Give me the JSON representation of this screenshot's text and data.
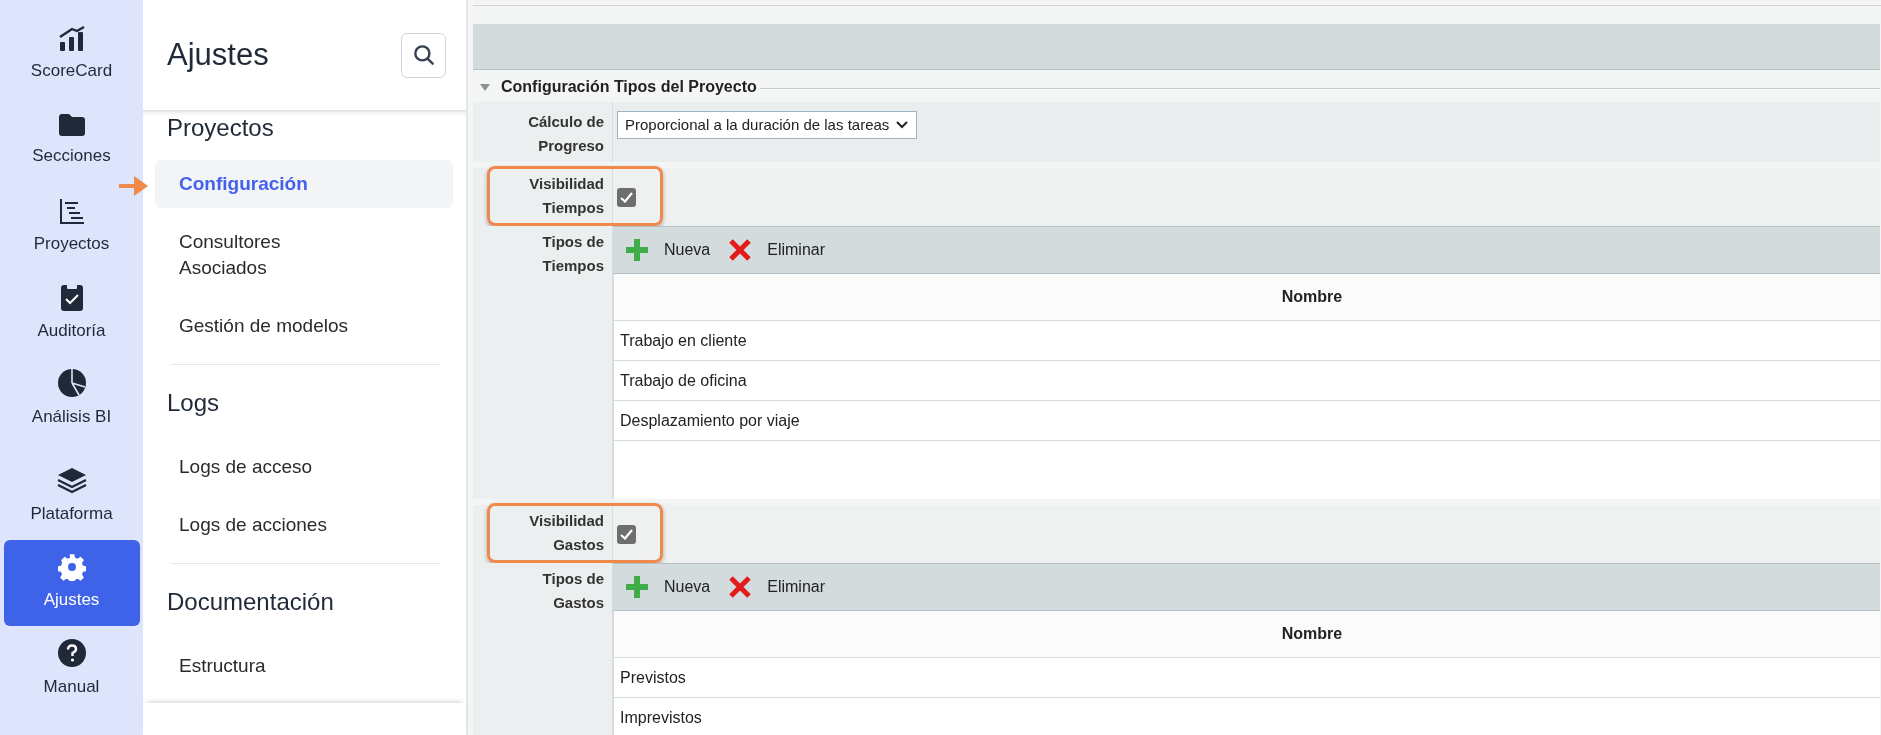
{
  "rail": [
    {
      "label": "ScoreCard",
      "selected": false
    },
    {
      "label": "Secciones",
      "selected": false
    },
    {
      "label": "Proyectos",
      "selected": false
    },
    {
      "label": "Auditoría",
      "selected": false
    },
    {
      "label": "Análisis BI",
      "selected": false
    },
    {
      "label": "Plataforma",
      "selected": false
    },
    {
      "label": "Ajustes",
      "selected": true
    },
    {
      "label": "Manual",
      "selected": false
    }
  ],
  "settings_panel": {
    "title": "Ajustes",
    "sections": [
      {
        "heading": "Proyectos",
        "items": [
          {
            "label": "Configuración",
            "selected": true,
            "pointed": true
          },
          {
            "label": "Consultores Asociados",
            "selected": false,
            "pointed": false
          },
          {
            "label": "Gestión de modelos",
            "selected": false,
            "pointed": false
          }
        ]
      },
      {
        "heading": "Logs",
        "items": [
          {
            "label": "Logs de acceso",
            "selected": false,
            "pointed": false
          },
          {
            "label": "Logs de acciones",
            "selected": false,
            "pointed": false
          }
        ]
      },
      {
        "heading": "Documentación",
        "items": [
          {
            "label": "Estructura",
            "selected": false,
            "pointed": false
          }
        ]
      }
    ]
  },
  "content": {
    "section_title": "Configuración Tipos del Proyecto",
    "expanded": true,
    "rows": [
      {
        "kind": "select",
        "label": "Cálculo de Progreso",
        "value": "Proporcional a la duración de las tareas"
      },
      {
        "kind": "checkbox",
        "label": "Visibilidad Tiempos",
        "checked": true,
        "highlighted": true
      },
      {
        "kind": "table",
        "label": "Tipos de Tiempos",
        "toolbar": [
          "Nueva",
          "Eliminar"
        ],
        "column": "Nombre",
        "items": [
          "Trabajo en cliente",
          "Trabajo de oficina",
          "Desplazamiento por viaje"
        ]
      },
      {
        "kind": "checkbox",
        "label": "Visibilidad Gastos",
        "checked": true,
        "highlighted": true
      },
      {
        "kind": "table",
        "label": "Tipos de Gastos",
        "toolbar": [
          "Nueva",
          "Eliminar"
        ],
        "column": "Nombre",
        "items": [
          "Previstos",
          "Imprevistos"
        ]
      }
    ]
  }
}
